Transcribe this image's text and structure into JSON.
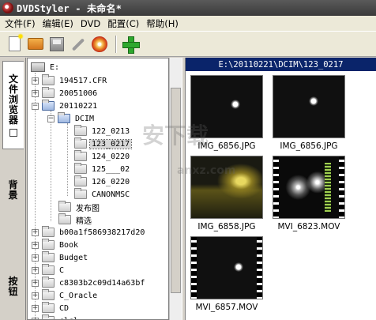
{
  "window": {
    "title": "DVDStyler - 未命名*"
  },
  "menu": {
    "items": [
      "文件(F)",
      "编辑(E)",
      "DVD",
      "配置(C)",
      "帮助(H)"
    ]
  },
  "toolbar": {
    "icons": [
      "new-file-icon",
      "open-folder-icon",
      "save-icon",
      "settings-wrench-icon",
      "burn-disc-icon",
      "add-icon"
    ]
  },
  "side_tabs": [
    "文件浏览器",
    "背景",
    "按钮"
  ],
  "tree": {
    "root": "E:",
    "nodes": [
      "194517.CFR",
      "20051006",
      "20110221",
      "DCIM",
      "122_0213",
      "123_0217",
      "124_0220",
      "125___02",
      "126_0220",
      "CANONMSC",
      "发布图",
      "精选",
      "b00a1f586938217d20",
      "Book",
      "Budget",
      "C",
      "c8303b2c09d14a63bf",
      "C_Oracle",
      "CD",
      "clcl"
    ]
  },
  "browser": {
    "path": "E:\\20110221\\DCIM\\123_0217",
    "files": [
      "IMG_6856.JPG",
      "IMG_6856.JPG",
      "IMG_6858.JPG",
      "MVI_6823.MOV",
      "MVI_6857.MOV"
    ]
  },
  "watermark": {
    "text": "安下载",
    "sub": "anxz.com"
  },
  "colors": {
    "path_bar": "#0a246a",
    "titlebar": "#3a3a3a",
    "selection": "#d8d8d8"
  }
}
